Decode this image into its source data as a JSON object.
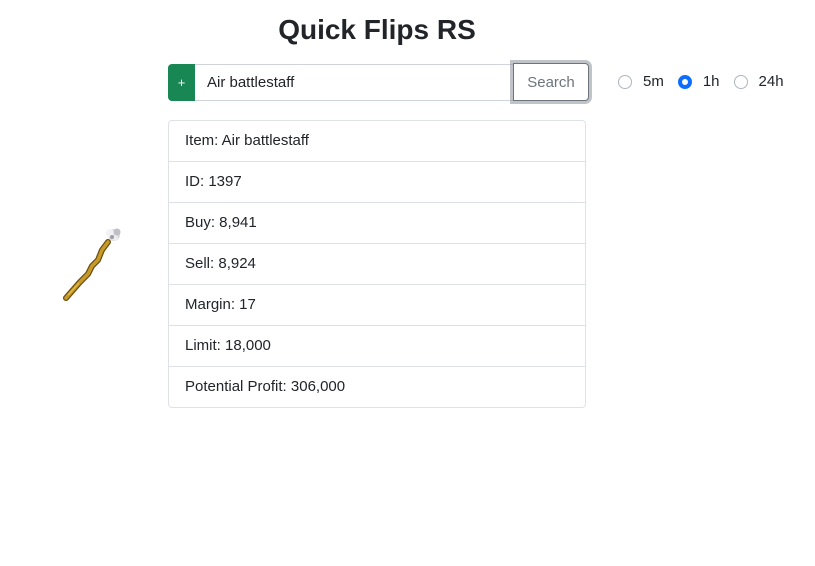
{
  "app": {
    "title": "Quick Flips RS"
  },
  "search": {
    "add_label": "+",
    "value": "Air battlestaff",
    "button_label": "Search"
  },
  "timeframes": {
    "options": [
      "5m",
      "1h",
      "24h"
    ],
    "selected": "1h"
  },
  "item": {
    "name_line": "Item: Air battlestaff",
    "id_line": "ID: 1397",
    "buy_line": "Buy: 8,941",
    "sell_line": "Sell: 8,924",
    "margin_line": "Margin: 17",
    "limit_line": "Limit: 18,000",
    "profit_line": "Potential Profit: 306,000",
    "image_icon": "battlestaff-icon"
  },
  "colors": {
    "add_button": "#198754",
    "radio_selected": "#0d6efd"
  }
}
